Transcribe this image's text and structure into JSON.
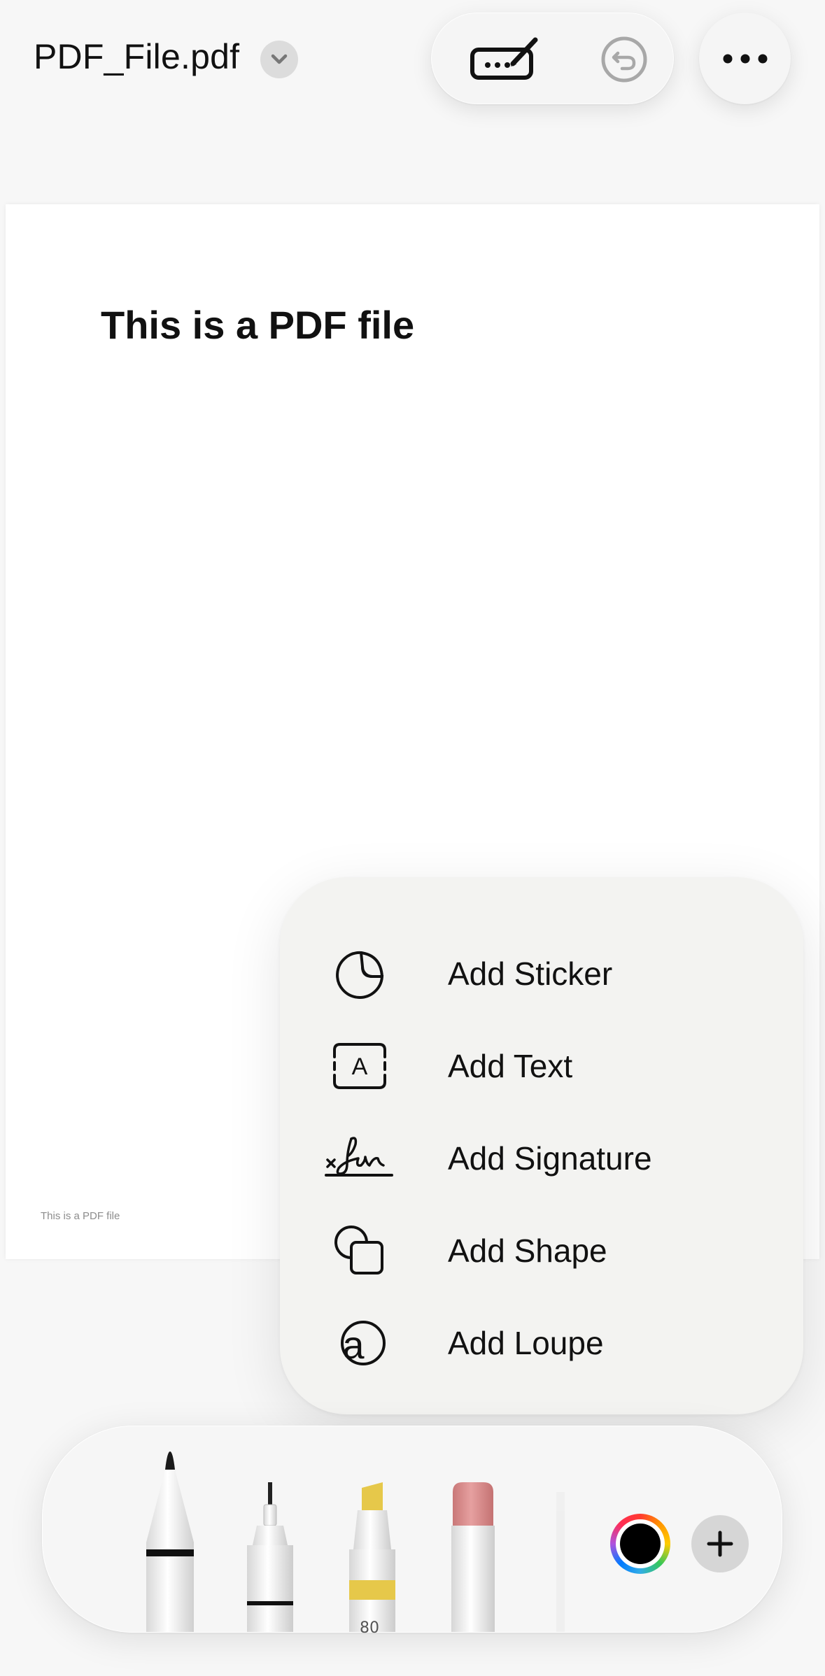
{
  "header": {
    "file_title": "PDF_File.pdf",
    "icons": [
      "chevron-down-icon",
      "markup-pen-icon",
      "undo-icon",
      "more-icon"
    ]
  },
  "document": {
    "heading": "This is a PDF file",
    "footer_text": "This is a PDF file"
  },
  "add_menu": {
    "items": [
      {
        "label": "Add Sticker",
        "icon": "sticker-icon"
      },
      {
        "label": "Add Text",
        "icon": "text-box-icon"
      },
      {
        "label": "Add Signature",
        "icon": "signature-icon"
      },
      {
        "label": "Add Shape",
        "icon": "shape-icon"
      },
      {
        "label": "Add Loupe",
        "icon": "loupe-icon"
      }
    ]
  },
  "palette": {
    "tools": [
      "pen",
      "fineliner",
      "highlighter",
      "eraser"
    ],
    "highlighter_number": "80",
    "selected_color": "#000000",
    "highlighter_color": "#e6c84a",
    "eraser_color": "#d98b8b"
  }
}
